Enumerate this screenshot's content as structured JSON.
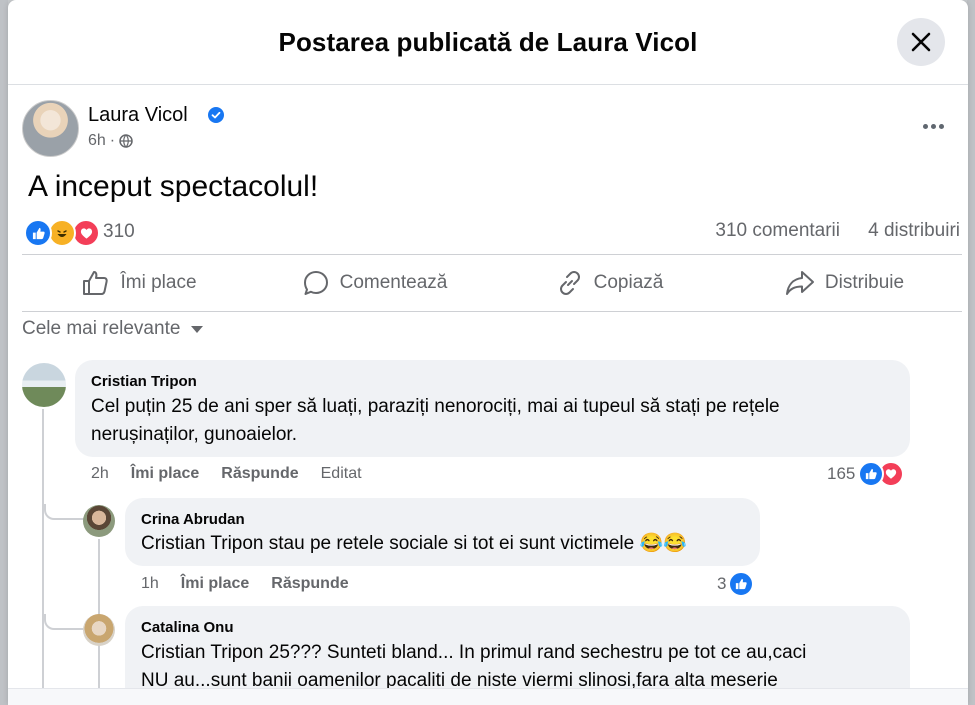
{
  "modal": {
    "title": "Postarea publicată de Laura Vicol",
    "close_icon": "close-icon"
  },
  "post": {
    "author": "Laura Vicol",
    "time": "6h",
    "privacy_separator": "·",
    "text": "A inceput spectacolul!",
    "reactions_count": "310",
    "comments": "310 comentarii",
    "shares": "4 distribuiri"
  },
  "actions": [
    {
      "label": "Îmi place",
      "icon": "thumbs-up-icon"
    },
    {
      "label": "Comentează",
      "icon": "comment-icon"
    },
    {
      "label": "Copiază",
      "icon": "link-icon"
    },
    {
      "label": "Distribuie",
      "icon": "share-icon"
    }
  ],
  "sort": {
    "label": "Cele mai relevante"
  },
  "comments": [
    {
      "name": "Cristian Tripon",
      "line1": "Cel puțin 25 de ani sper să luați, paraziți nenorociți, mai ai tupeul să stați pe rețele",
      "line2": "nerușinaților, gunoaielor.",
      "time": "2h",
      "like": "Îmi place",
      "reply": "Răspunde",
      "edited": "Editat",
      "reactions": "165"
    },
    {
      "name": "Crina Abrudan",
      "tag": "Cristian Tripon",
      "text": " stau pe retele sociale si tot ei sunt victimele ",
      "emoji": "😂😂",
      "time": "1h",
      "like": "Îmi place",
      "reply": "Răspunde",
      "reactions": "3"
    },
    {
      "name": "Catalina Onu",
      "tag": "Cristian Tripon",
      "line1": " 25??? Sunteti bland... In primul rand sechestru pe tot ce au,caci",
      "line2": "NU au...sunt banii oamenilor pacaliti de niste viermi slinosi,fara alta meserie"
    }
  ],
  "colors": {
    "accent": "#1877f2",
    "love": "#f33e58",
    "haha": "#f7b125"
  }
}
